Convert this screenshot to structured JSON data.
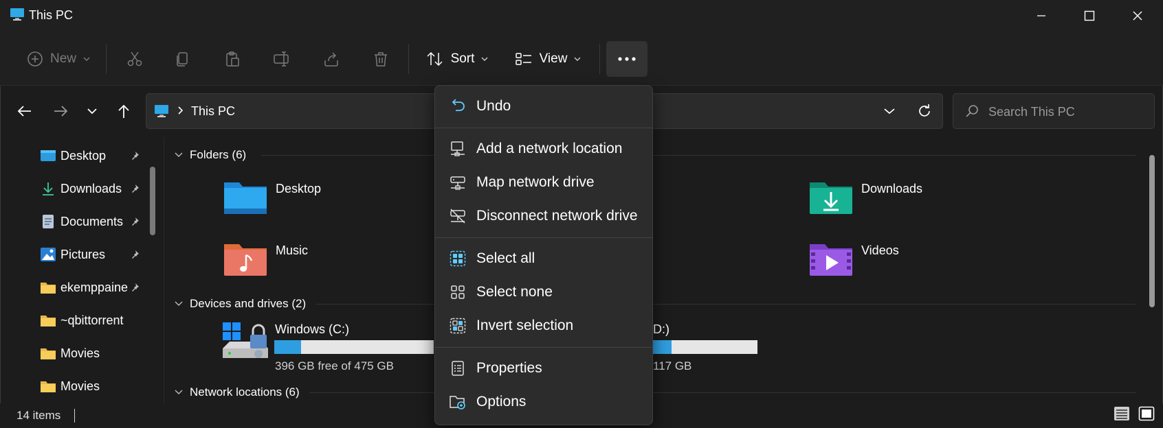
{
  "window": {
    "title": "This PC"
  },
  "toolbar": {
    "new_label": "New",
    "sort_label": "Sort",
    "view_label": "View"
  },
  "address": {
    "location": "This PC"
  },
  "search": {
    "placeholder": "Search This PC"
  },
  "sidebar": {
    "items": [
      {
        "label": "Desktop",
        "icon": "desktop-icon",
        "pinned": true
      },
      {
        "label": "Downloads",
        "icon": "download-icon",
        "pinned": true
      },
      {
        "label": "Documents",
        "icon": "document-icon",
        "pinned": true
      },
      {
        "label": "Pictures",
        "icon": "picture-icon",
        "pinned": true
      },
      {
        "label": "ekemppaine",
        "icon": "folder-icon",
        "pinned": true
      },
      {
        "label": "~qbittorrent",
        "icon": "folder-icon",
        "pinned": false
      },
      {
        "label": "Movies",
        "icon": "folder-icon",
        "pinned": false
      },
      {
        "label": "Movies",
        "icon": "folder-icon",
        "pinned": false
      }
    ]
  },
  "content": {
    "folders_header": "Folders (6)",
    "folders": [
      {
        "label": "Desktop",
        "icon": "desktop-folder-icon"
      },
      {
        "label": "Downloads",
        "icon": "downloads-folder-icon"
      },
      {
        "label": "Music",
        "icon": "music-folder-icon"
      },
      {
        "label": "Videos",
        "icon": "videos-folder-icon"
      }
    ],
    "devices_header": "Devices and drives (2)",
    "drives": [
      {
        "label": "Windows (C:)",
        "free_text": "396 GB free of 475 GB",
        "used_fraction": 0.17
      },
      {
        "label": "(D:)",
        "free_text": "117 GB",
        "used_fraction": 0.18
      }
    ],
    "network_header": "Network locations (6)"
  },
  "status": {
    "items_text": "14 items"
  },
  "menu": {
    "items": [
      {
        "label": "Undo",
        "icon": "undo-icon"
      },
      {
        "label": "Add a network location",
        "icon": "network-location-icon"
      },
      {
        "label": "Map network drive",
        "icon": "map-drive-icon"
      },
      {
        "label": "Disconnect network drive",
        "icon": "disconnect-drive-icon"
      },
      {
        "label": "Select all",
        "icon": "select-all-icon"
      },
      {
        "label": "Select none",
        "icon": "select-none-icon"
      },
      {
        "label": "Invert selection",
        "icon": "invert-selection-icon"
      },
      {
        "label": "Properties",
        "icon": "properties-icon"
      },
      {
        "label": "Options",
        "icon": "options-icon"
      }
    ]
  },
  "colors": {
    "accent": "#60cdff",
    "drive_bar": "#2f9ee0",
    "background": "#191919"
  }
}
